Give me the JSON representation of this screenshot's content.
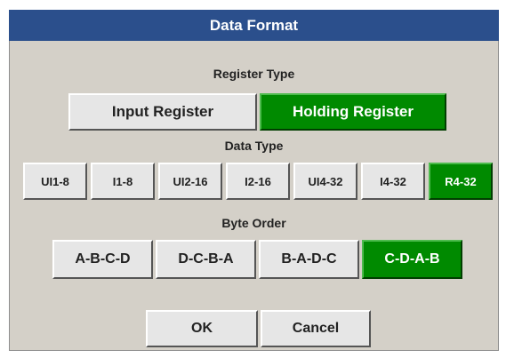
{
  "window": {
    "title": "Data Format"
  },
  "register_type": {
    "label": "Register Type",
    "options": [
      "Input Register",
      "Holding Register"
    ],
    "selected": "Holding Register"
  },
  "data_type": {
    "label": "Data Type",
    "options": [
      "UI1-8",
      "I1-8",
      "UI2-16",
      "I2-16",
      "UI4-32",
      "I4-32",
      "R4-32"
    ],
    "selected": "R4-32"
  },
  "byte_order": {
    "label": "Byte Order",
    "options": [
      "A-B-C-D",
      "D-C-B-A",
      "B-A-D-C",
      "C-D-A-B"
    ],
    "selected": "C-D-A-B"
  },
  "actions": {
    "ok_label": "OK",
    "cancel_label": "Cancel"
  },
  "colors": {
    "title_bar": "#2b4f8c",
    "selected_button": "#008a00",
    "dialog_background": "#d4d0c8"
  }
}
